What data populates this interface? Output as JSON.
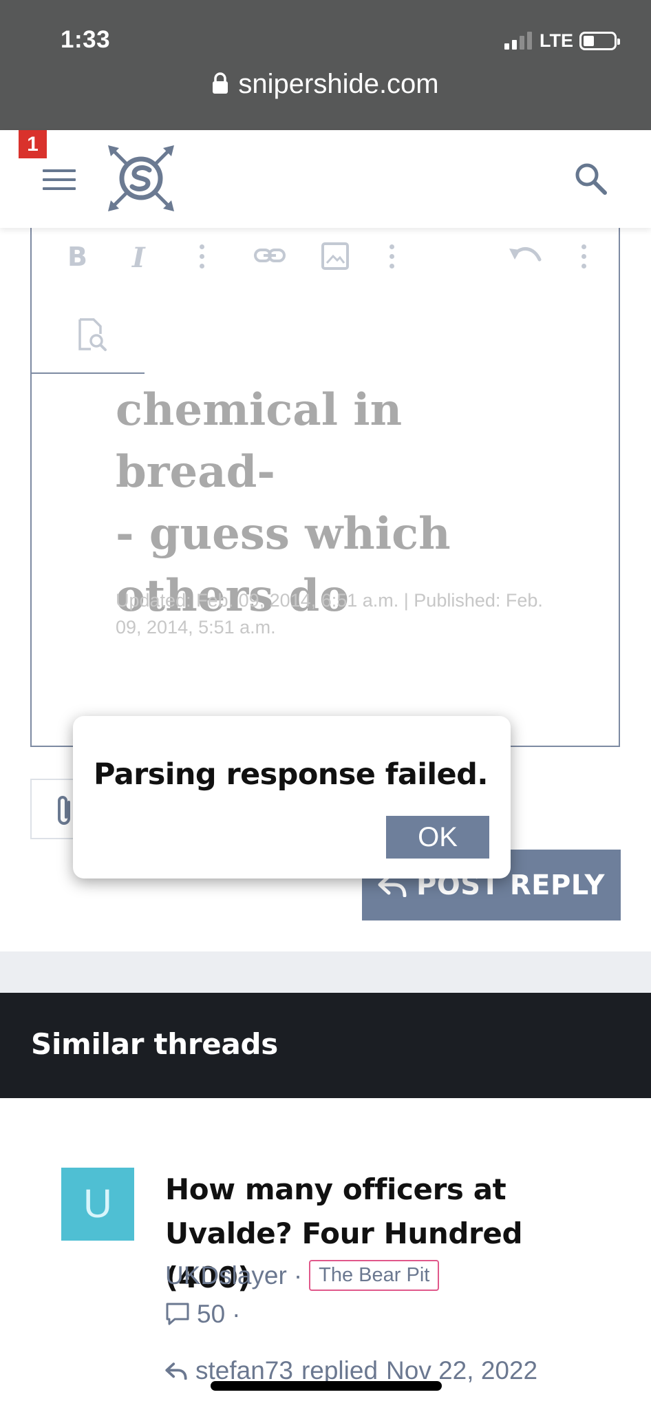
{
  "status_bar": {
    "time": "1:33",
    "network": "LTE",
    "url": "snipershide.com"
  },
  "header": {
    "notification_count": "1",
    "icons": [
      "menu-icon",
      "snipershide-logo",
      "search-icon"
    ]
  },
  "editor": {
    "toolbar_icons": [
      "bold-icon",
      "italic-icon",
      "more-icon",
      "link-icon",
      "image-icon",
      "more-icon",
      "undo-icon",
      "more-icon"
    ],
    "bold_glyph": "B",
    "italic_glyph": "I",
    "headline": "chemical in bread-- guess which others do",
    "headline_lines": [
      "chemical in bread-",
      "- guess which",
      "others do"
    ],
    "dateline": "Updated: Feb. 09, 2014, 6:51 a.m. | Published: Feb. 09, 2014, 5:51 a.m."
  },
  "post_reply": {
    "label": "POST REPLY"
  },
  "dialog": {
    "message": "Parsing response failed.",
    "ok_label": "OK"
  },
  "similar_threads": {
    "heading": "Similar threads",
    "items": [
      {
        "avatar_letter": "U",
        "title": "How many officers at Uvalde? Four Hundred (400)",
        "author": "UKDslayer",
        "separator": "·",
        "forum": "The Bear Pit",
        "replies": "50",
        "stats_suffix": "·",
        "last_user": "stefan73",
        "last_action": "replied",
        "last_date": "Nov 22, 2022"
      }
    ]
  },
  "colors": {
    "status_bar_bg": "#575858",
    "accent_slate": "#6e7f9b",
    "badge_red": "#d9322c",
    "avatar_teal": "#4fbfd3",
    "dark_section": "#1b1e23",
    "forum_tag_border": "#e0588a"
  }
}
